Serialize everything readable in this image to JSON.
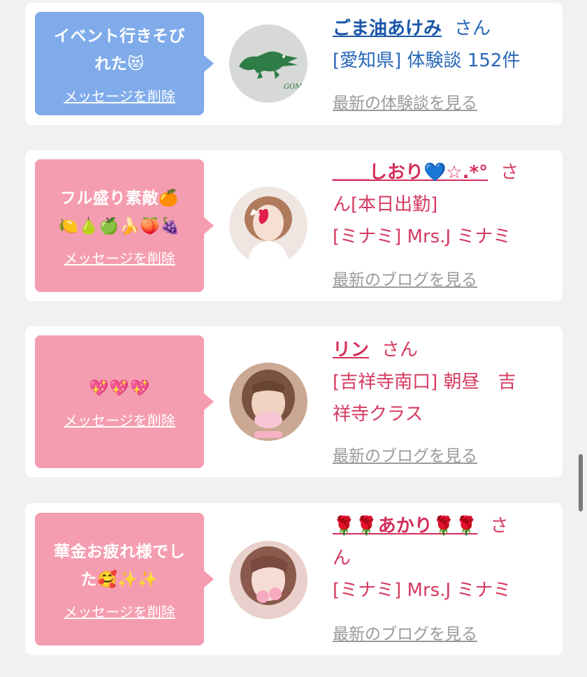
{
  "delete_label": "メッセージを削除",
  "colors": {
    "blue_bubble": "#7fabeb",
    "pink_bubble": "#f59db0",
    "blue_text": "#2866b8",
    "pink_text": "#d63a60"
  },
  "cards": [
    {
      "bubble_lines": [
        "イベント行きそび",
        "れた😻"
      ],
      "avatar_icon": "crocodile-logo",
      "avatar_text": "GOMA",
      "name": "ごま油あけみ",
      "suffix": "さん",
      "info_lines": [
        "[愛知県] 体験談 152件"
      ],
      "more_link": "最新の体験談を見る"
    },
    {
      "bubble_lines": [
        "フル盛り素敵🍊",
        "🍋🍐🍏🍌🍑🍇"
      ],
      "avatar_icon": "woman-photo",
      "name": "＿＿しおり💙☆.*°",
      "suffix": "さ",
      "info_lines": [
        "ん[本日出勤]",
        "[ミナミ] Mrs.J ミナミ"
      ],
      "more_link": "最新のブログを見る"
    },
    {
      "bubble_lines": [
        "💖💖💖"
      ],
      "avatar_icon": "woman-photo",
      "name": "リン",
      "suffix": "さん",
      "info_lines": [
        "[吉祥寺南口] 朝昼　吉",
        "祥寺クラス"
      ],
      "more_link": "最新のブログを見る"
    },
    {
      "bubble_lines": [
        "華金お疲れ様でし",
        "た🥰✨✨"
      ],
      "avatar_icon": "woman-photo",
      "name": "🌹🌹あかり🌹🌹",
      "suffix": "さ",
      "info_lines": [
        "ん",
        "[ミナミ] Mrs.J ミナミ"
      ],
      "more_link": "最新のブログを見る"
    }
  ]
}
